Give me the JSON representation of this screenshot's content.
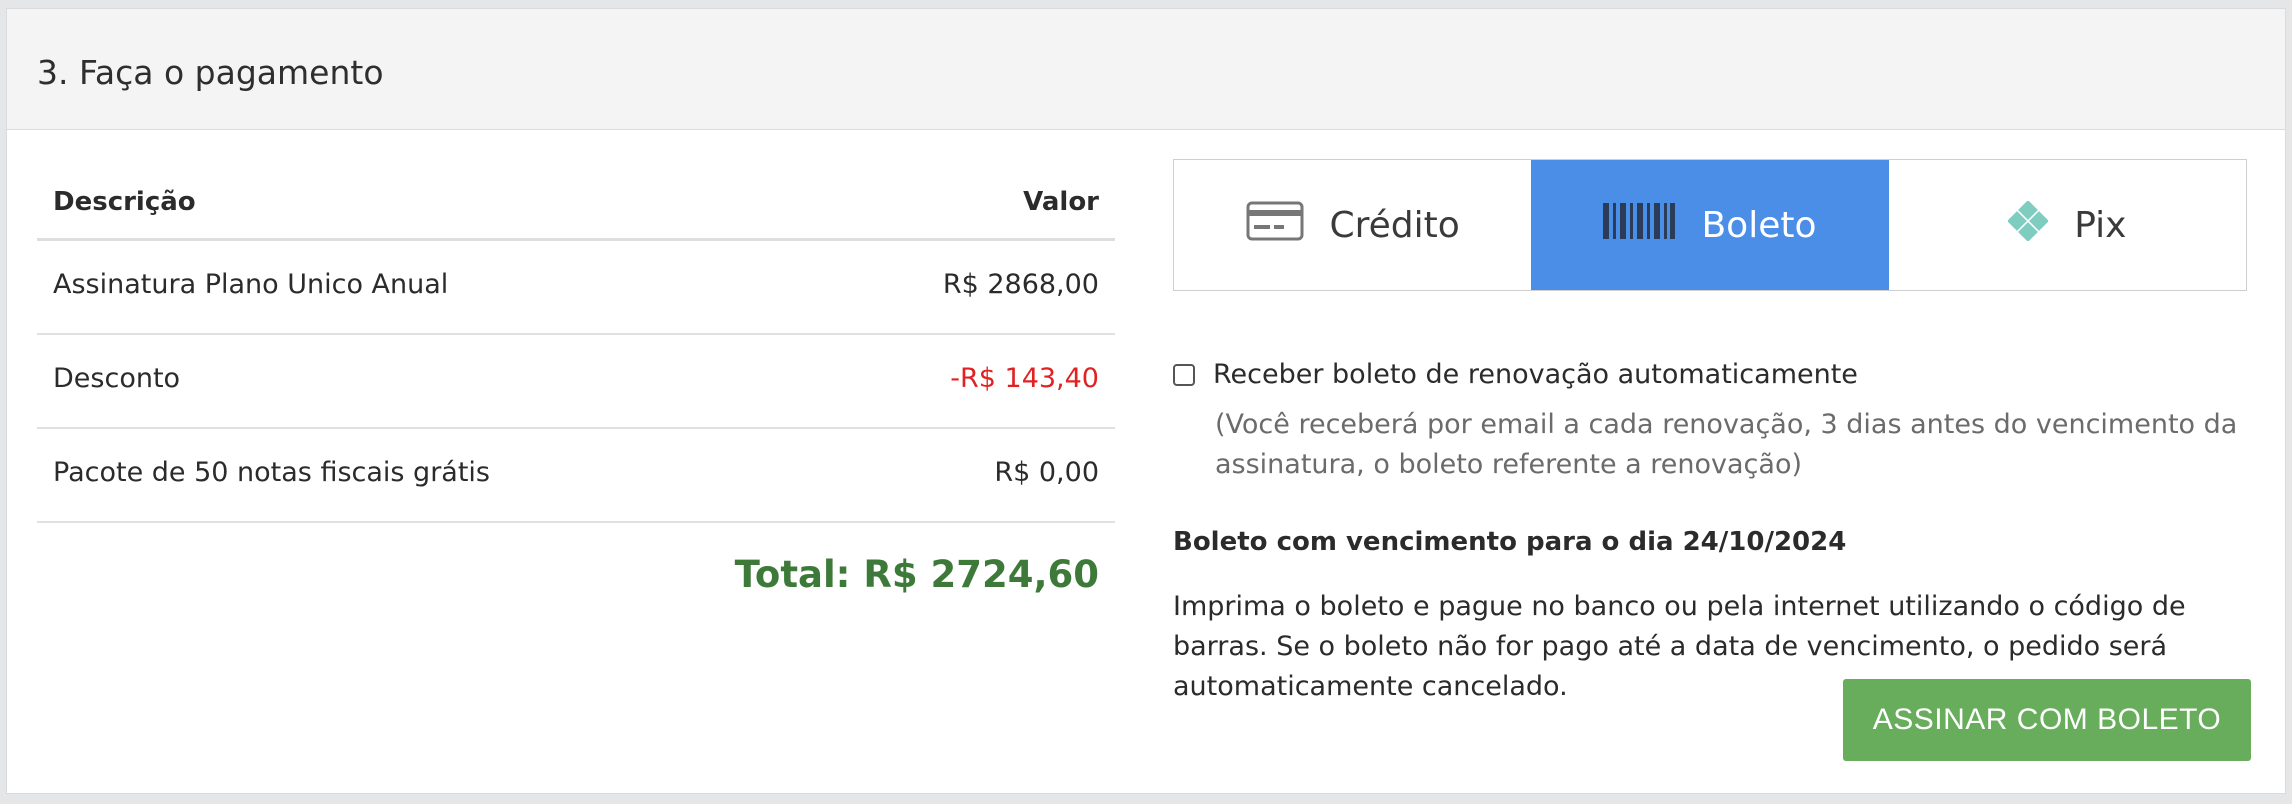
{
  "header": {
    "title": "3. Faça o pagamento"
  },
  "table": {
    "columns": {
      "description": "Descrição",
      "value": "Valor"
    },
    "rows": [
      {
        "description": "Assinatura Plano Unico Anual",
        "value": "R$ 2868,00"
      },
      {
        "description": "Desconto",
        "value": "-R$ 143,40"
      },
      {
        "description": "Pacote de 50 notas fiscais grátis",
        "value": "R$ 0,00"
      }
    ],
    "total": "Total: R$ 2724,60"
  },
  "tabs": [
    {
      "label": "Crédito",
      "icon": "credit-card-icon",
      "active": false
    },
    {
      "label": "Boleto",
      "icon": "barcode-icon",
      "active": true
    },
    {
      "label": "Pix",
      "icon": "pix-icon",
      "active": false
    }
  ],
  "boleto": {
    "renew_label": "Receber boleto de renovação automaticamente",
    "renew_checked": false,
    "renew_hint": "(Você receberá por email a cada renovação, 3 dias antes do vencimento da assinatura, o boleto referente a renovação)",
    "due_label": "Boleto com vencimento para o dia 24/10/2024",
    "instructions": "Imprima o boleto e pague no banco ou pela internet utilizando o código de barras. Se o boleto não for pago até a data de vencimento, o pedido será automaticamente cancelado.",
    "submit_label": "ASSINAR COM BOLETO"
  },
  "colors": {
    "active_tab": "#4a8ee8",
    "discount": "#e02222",
    "total": "#3d7a3a",
    "submit_button": "#67ad5b",
    "pix_icon": "#7ecdc0"
  }
}
